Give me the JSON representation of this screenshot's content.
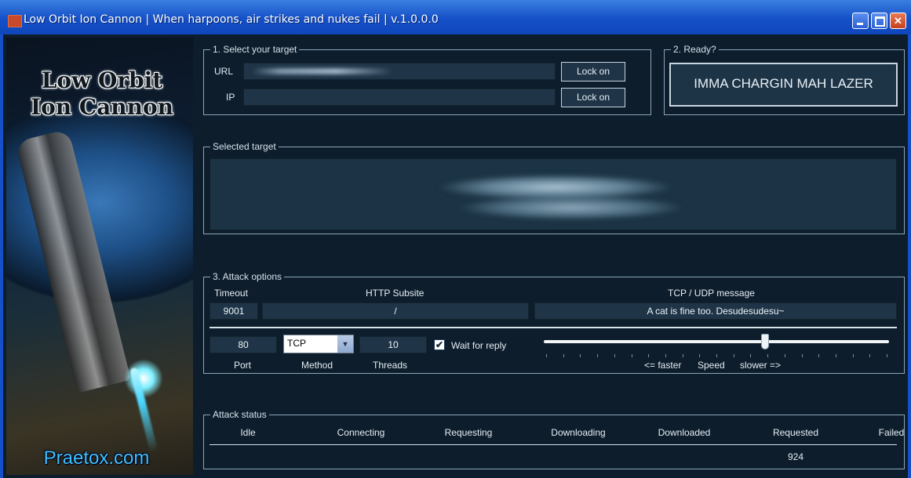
{
  "window": {
    "title": "Low Orbit Ion Cannon | When harpoons, air strikes and nukes fail | v.1.0.0.0",
    "min_glyph": "",
    "max_glyph": "",
    "close_glyph": "✕"
  },
  "brand": {
    "title_line1": "Low Orbit",
    "title_line2": "Ion Cannon",
    "url": "Praetox.com"
  },
  "target": {
    "group_label": "1. Select your target",
    "url_label": "URL",
    "url_value": "",
    "ip_label": "IP",
    "ip_value": "",
    "lock_on_url": "Lock on",
    "lock_on_ip": "Lock on"
  },
  "ready": {
    "group_label": "2. Ready?",
    "fire_button": "IMMA CHARGIN MAH LAZER"
  },
  "selected_target": {
    "group_label": "Selected target",
    "value": ""
  },
  "attack_options": {
    "group_label": "3. Attack options",
    "timeout_label": "Timeout",
    "timeout_value": "9001",
    "subsite_label": "HTTP Subsite",
    "subsite_value": "/",
    "message_label": "TCP / UDP message",
    "message_value": "A cat is fine too. Desudesudesu~",
    "port_value": "80",
    "port_label": "Port",
    "method_value": "TCP",
    "method_label": "Method",
    "threads_value": "10",
    "threads_label": "Threads",
    "wait_label": "Wait for reply",
    "wait_checked": "✔",
    "speed_faster": "<= faster",
    "speed_label": "Speed",
    "speed_slower": "slower =>",
    "speed_level": 0.64
  },
  "attack_status": {
    "group_label": "Attack status",
    "columns": [
      "Idle",
      "Connecting",
      "Requesting",
      "Downloading",
      "Downloaded",
      "Requested",
      "Failed"
    ],
    "values": [
      "",
      "",
      "",
      "",
      "",
      "924",
      ""
    ]
  }
}
